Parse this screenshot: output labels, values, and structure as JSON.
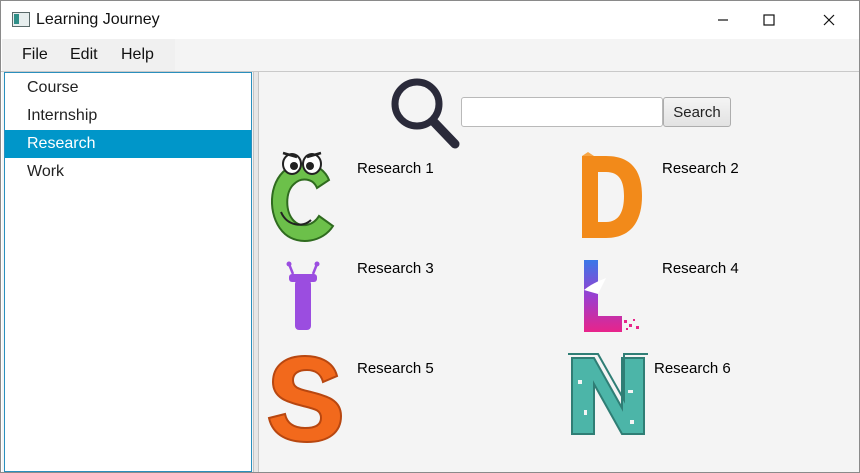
{
  "window": {
    "title": "Learning Journey",
    "minimize_label": "Minimize",
    "maximize_label": "Maximize",
    "close_label": "Close"
  },
  "menu": {
    "items": [
      "File",
      "Edit",
      "Help"
    ]
  },
  "sidebar": {
    "items": [
      "Course",
      "Internship",
      "Research",
      "Work"
    ],
    "selected": "Research"
  },
  "search": {
    "value": "",
    "placeholder": "",
    "button_label": "Search"
  },
  "research_items": [
    {
      "label": "Research 1",
      "letter": "C",
      "icon": "letter-c-cartoon-icon"
    },
    {
      "label": "Research 2",
      "letter": "D",
      "icon": "letter-d-orange-icon"
    },
    {
      "label": "Research 3",
      "letter": "I",
      "icon": "letter-i-purple-icon"
    },
    {
      "label": "Research 4",
      "letter": "L",
      "icon": "letter-l-gradient-icon"
    },
    {
      "label": "Research 5",
      "letter": "S",
      "icon": "letter-s-orange-icon"
    },
    {
      "label": "Research 6",
      "letter": "N",
      "icon": "letter-n-teal-icon"
    }
  ],
  "colors": {
    "selection": "#0096c9",
    "list_border": "#2a8fbd",
    "c_green": "#6cc04a",
    "d_orange": "#f28a1a",
    "i_purple": "#9b4de0",
    "l_gradient_top": "#3a78e8",
    "l_gradient_bottom": "#e8248a",
    "s_orange": "#f2691c",
    "n_teal": "#4cb5a8"
  }
}
